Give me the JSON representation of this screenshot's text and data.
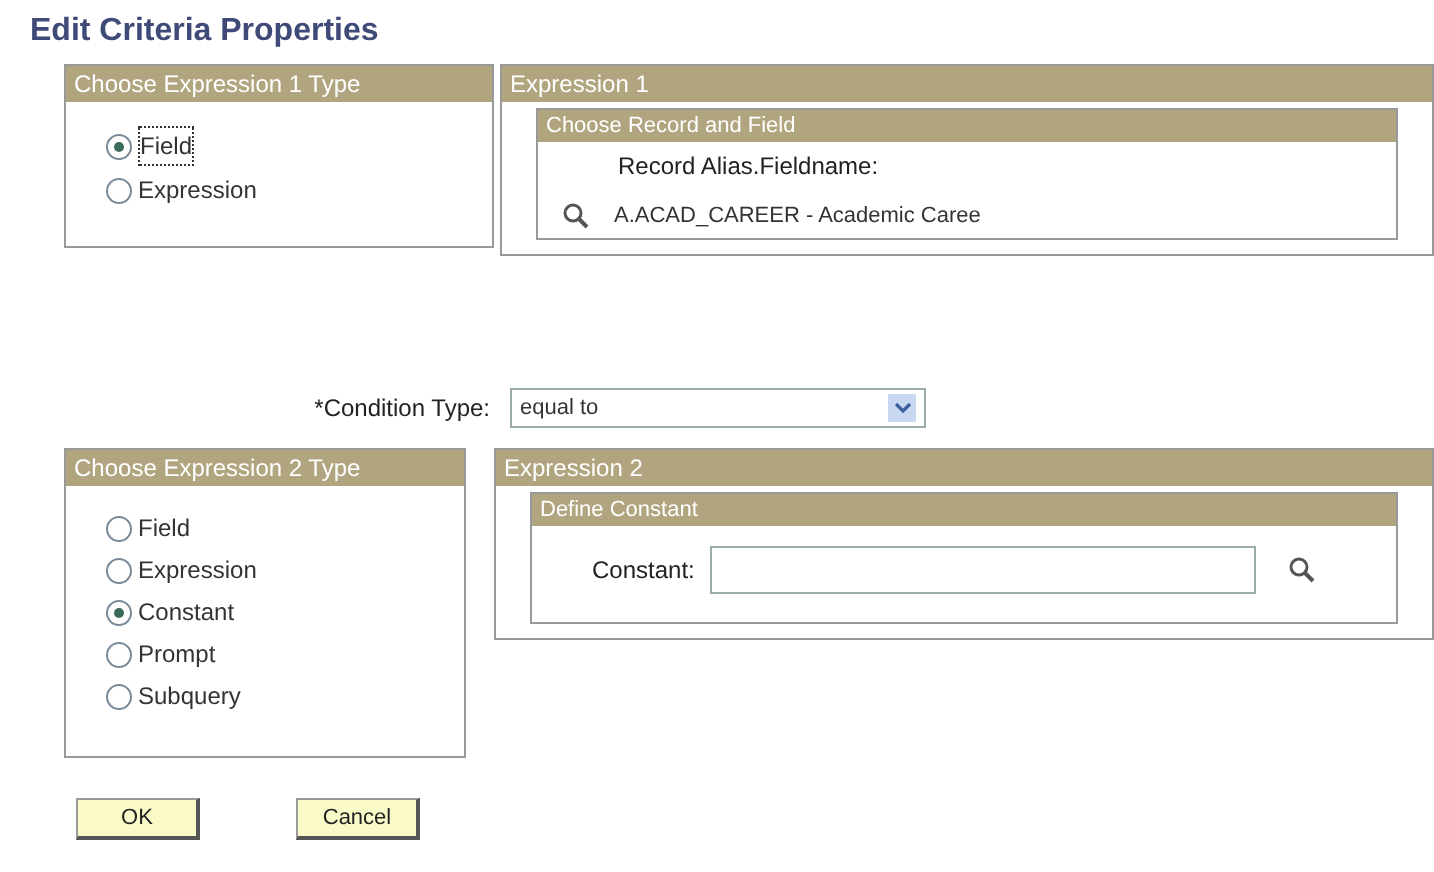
{
  "title": "Edit Criteria Properties",
  "expression1_type": {
    "title": "Choose Expression 1 Type",
    "options": [
      {
        "label": "Field",
        "selected": true
      },
      {
        "label": "Expression",
        "selected": false
      }
    ]
  },
  "expression1": {
    "title": "Expression 1",
    "group": {
      "title": "Choose Record and Field",
      "label": "Record Alias.Fieldname:",
      "value": "A.ACAD_CAREER - Academic Caree"
    }
  },
  "condition_type": {
    "label": "*Condition Type:",
    "value": "equal to"
  },
  "expression2_type": {
    "title": "Choose Expression 2 Type",
    "options": [
      {
        "label": "Field",
        "selected": false
      },
      {
        "label": "Expression",
        "selected": false
      },
      {
        "label": "Constant",
        "selected": true
      },
      {
        "label": "Prompt",
        "selected": false
      },
      {
        "label": "Subquery",
        "selected": false
      }
    ]
  },
  "expression2": {
    "title": "Expression 2",
    "group": {
      "title": "Define Constant",
      "label": "Constant:"
    }
  },
  "buttons": [
    "OK",
    "Cancel"
  ]
}
